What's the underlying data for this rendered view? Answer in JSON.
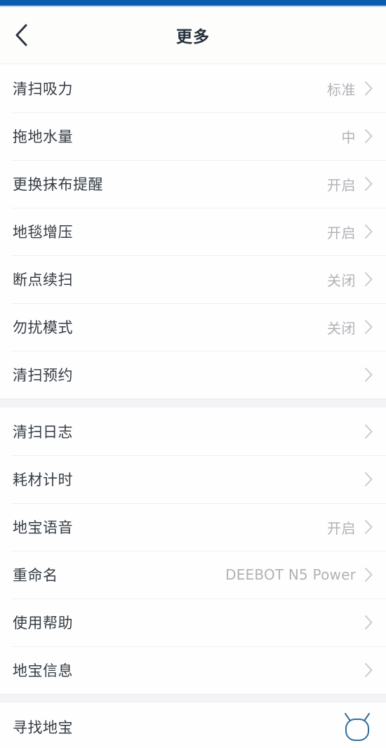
{
  "statusbar": {
    "color": "#0b5cae"
  },
  "header": {
    "title": "更多",
    "back_icon": "chevron-left-icon"
  },
  "colors": {
    "accent": "#0b5cae",
    "label": "#353c45",
    "value": "#b0b2b6",
    "divider": "#f0f0f2",
    "robot_icon": "#2e6e9e"
  },
  "groups": [
    {
      "rows": [
        {
          "label": "清扫吸力",
          "value": "标准",
          "icon": "chevron-right-icon"
        },
        {
          "label": "拖地水量",
          "value": "中",
          "icon": "chevron-right-icon"
        },
        {
          "label": "更换抹布提醒",
          "value": "开启",
          "icon": "chevron-right-icon"
        },
        {
          "label": "地毯增压",
          "value": "开启",
          "icon": "chevron-right-icon"
        },
        {
          "label": "断点续扫",
          "value": "关闭",
          "icon": "chevron-right-icon"
        },
        {
          "label": "勿扰模式",
          "value": "关闭",
          "icon": "chevron-right-icon"
        },
        {
          "label": "清扫预约",
          "value": "",
          "icon": "chevron-right-icon"
        }
      ]
    },
    {
      "rows": [
        {
          "label": "清扫日志",
          "value": "",
          "icon": "chevron-right-icon"
        },
        {
          "label": "耗材计时",
          "value": "",
          "icon": "chevron-right-icon"
        },
        {
          "label": "地宝语音",
          "value": "开启",
          "icon": "chevron-right-icon"
        },
        {
          "label": "重命名",
          "value": "DEEBOT N5 Power",
          "icon": "chevron-right-icon"
        },
        {
          "label": "使用帮助",
          "value": "",
          "icon": "chevron-right-icon"
        },
        {
          "label": "地宝信息",
          "value": "",
          "icon": "chevron-right-icon"
        }
      ]
    },
    {
      "rows": [
        {
          "label": "寻找地宝",
          "value": "",
          "icon": "robot-icon"
        }
      ]
    }
  ]
}
